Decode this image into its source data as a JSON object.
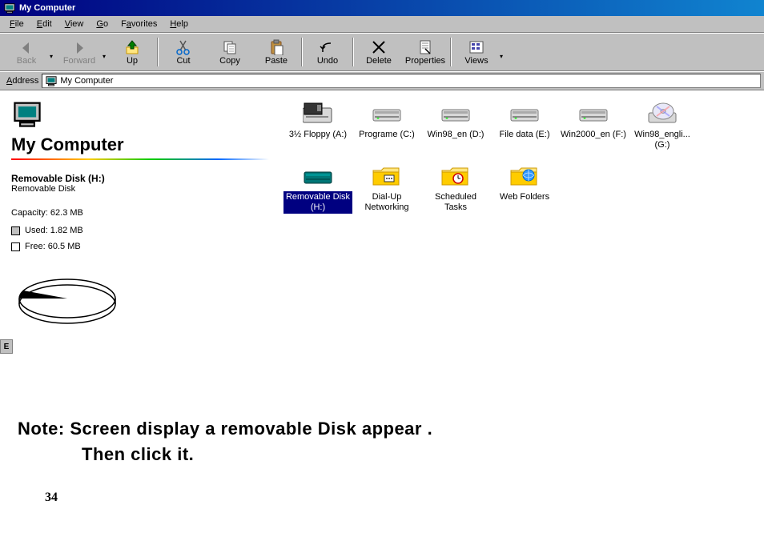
{
  "titlebar": {
    "title": "My Computer"
  },
  "menubar": {
    "file": "File",
    "edit": "Edit",
    "view": "View",
    "go": "Go",
    "favorites": "Favorites",
    "help": "Help"
  },
  "toolbar": {
    "back": "Back",
    "forward": "Forward",
    "up": "Up",
    "cut": "Cut",
    "copy": "Copy",
    "paste": "Paste",
    "undo": "Undo",
    "delete": "Delete",
    "properties": "Properties",
    "views": "Views"
  },
  "addressbar": {
    "label": "Address",
    "value": "My Computer"
  },
  "leftpane": {
    "heading": "My Computer",
    "selected_name": "Removable Disk (H:)",
    "selected_type": "Removable Disk",
    "capacity_label": "Capacity: 62.3 MB",
    "used_label": "Used: 1.82 MB",
    "free_label": "Free: 60.5 MB"
  },
  "drives": [
    {
      "label": "3½ Floppy (A:)",
      "icon": "floppy"
    },
    {
      "label": "Programe (C:)",
      "icon": "hdd"
    },
    {
      "label": "Win98_en (D:)",
      "icon": "hdd"
    },
    {
      "label": "File data (E:)",
      "icon": "hdd"
    },
    {
      "label": "Win2000_en (F:)",
      "icon": "hdd"
    },
    {
      "label": "Win98_engli... (G:)",
      "icon": "cd"
    },
    {
      "label": "Removable Disk (H:)",
      "icon": "removable",
      "selected": true
    },
    {
      "label": "Dial-Up Networking",
      "icon": "folder-dial"
    },
    {
      "label": "Scheduled Tasks",
      "icon": "folder-sched"
    },
    {
      "label": "Web Folders",
      "icon": "folder-web"
    }
  ],
  "etab": "E",
  "note": {
    "line1": "Note: Screen display a removable Disk appear .",
    "line2": "Then click it."
  },
  "page_number": "34"
}
